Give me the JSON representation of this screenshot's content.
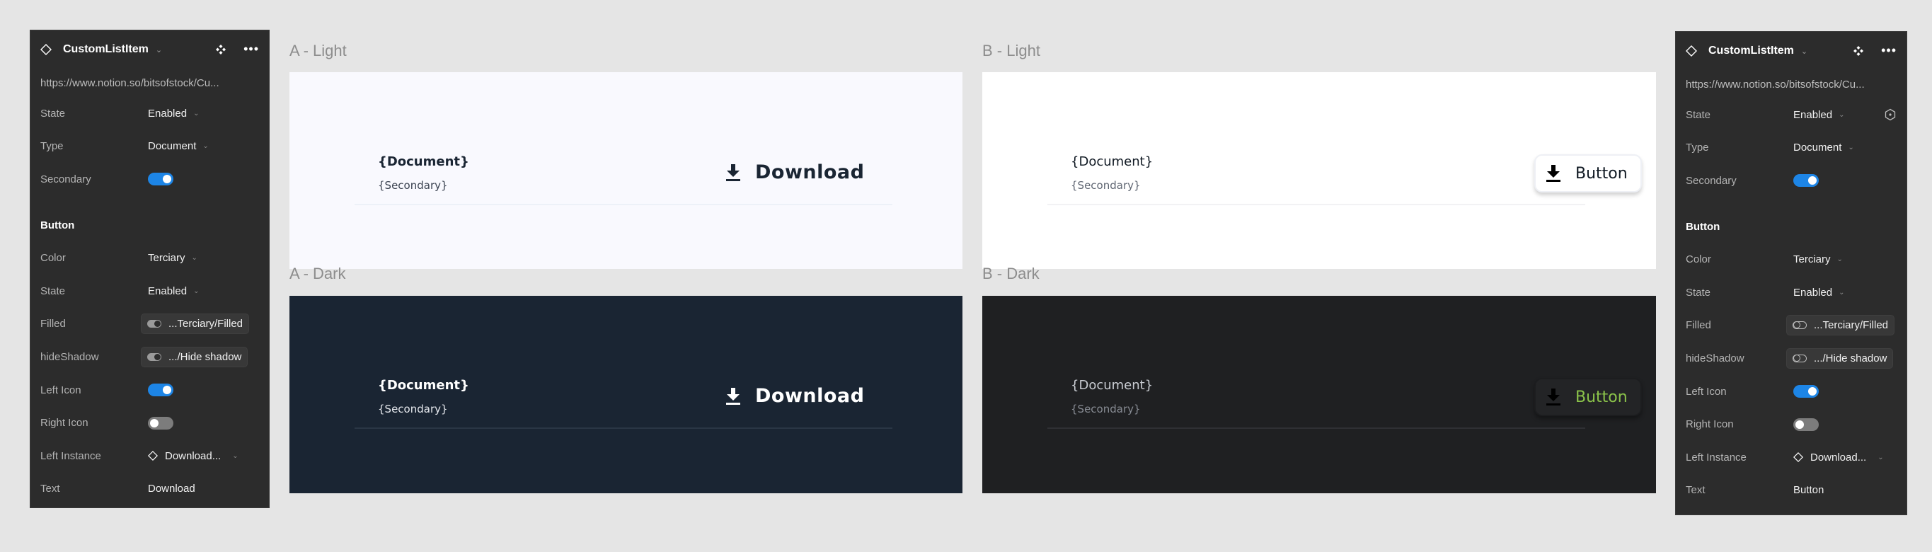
{
  "left_panel": {
    "component_name": "CustomListItem",
    "url": "https://www.notion.so/bitsofstock/Cu...",
    "props": [
      {
        "label": "State",
        "value": "Enabled"
      },
      {
        "label": "Type",
        "value": "Document"
      },
      {
        "label": "Secondary",
        "toggle": "on"
      }
    ],
    "button_section": "Button",
    "button_props": {
      "color": {
        "label": "Color",
        "value": "Terciary"
      },
      "state": {
        "label": "State",
        "value": "Enabled"
      },
      "filled": {
        "label": "Filled",
        "value": "...Terciary/Filled"
      },
      "hide_shadow": {
        "label": "hideShadow",
        "value": ".../Hide shadow"
      },
      "left_icon": {
        "label": "Left Icon",
        "toggle": "on"
      },
      "right_icon": {
        "label": "Right Icon",
        "toggle": "off"
      },
      "left_instance": {
        "label": "Left Instance",
        "value": "Download..."
      },
      "text": {
        "label": "Text",
        "value": "Download"
      }
    }
  },
  "right_panel": {
    "component_name": "CustomListItem",
    "url": "https://www.notion.so/bitsofstock/Cu...",
    "props": [
      {
        "label": "State",
        "value": "Enabled"
      },
      {
        "label": "Type",
        "value": "Document"
      },
      {
        "label": "Secondary",
        "toggle": "on"
      }
    ],
    "button_section": "Button",
    "button_props": {
      "color": {
        "label": "Color",
        "value": "Terciary"
      },
      "state": {
        "label": "State",
        "value": "Enabled"
      },
      "filled": {
        "label": "Filled",
        "value": "...Terciary/Filled"
      },
      "hide_shadow": {
        "label": "hideShadow",
        "value": ".../Hide shadow"
      },
      "left_icon": {
        "label": "Left Icon",
        "toggle": "on"
      },
      "right_icon": {
        "label": "Right Icon",
        "toggle": "off"
      },
      "left_instance": {
        "label": "Left Instance",
        "value": "Download..."
      },
      "text": {
        "label": "Text",
        "value": "Button"
      }
    }
  },
  "frames": {
    "a_light": {
      "label": "A - Light",
      "primary": "{Document}",
      "secondary": "{Secondary}",
      "button": "Download"
    },
    "a_dark": {
      "label": "A - Dark",
      "primary": "{Document}",
      "secondary": "{Secondary}",
      "button": "Download"
    },
    "b_light": {
      "label": "B - Light",
      "primary": "{Document}",
      "secondary": "{Secondary}",
      "button": "Button"
    },
    "b_dark": {
      "label": "B - Dark",
      "primary": "{Document}",
      "secondary": "{Secondary}",
      "button": "Button"
    }
  },
  "colors": {
    "toggle_on": "#1d85e6",
    "panel_bg": "#2c2c2c",
    "canvas_bg": "#e5e5e5",
    "a_dark_bg": "#1a2533",
    "b_dark_bg": "#1f2022",
    "b_dark_button_text": "#8bc34a"
  }
}
